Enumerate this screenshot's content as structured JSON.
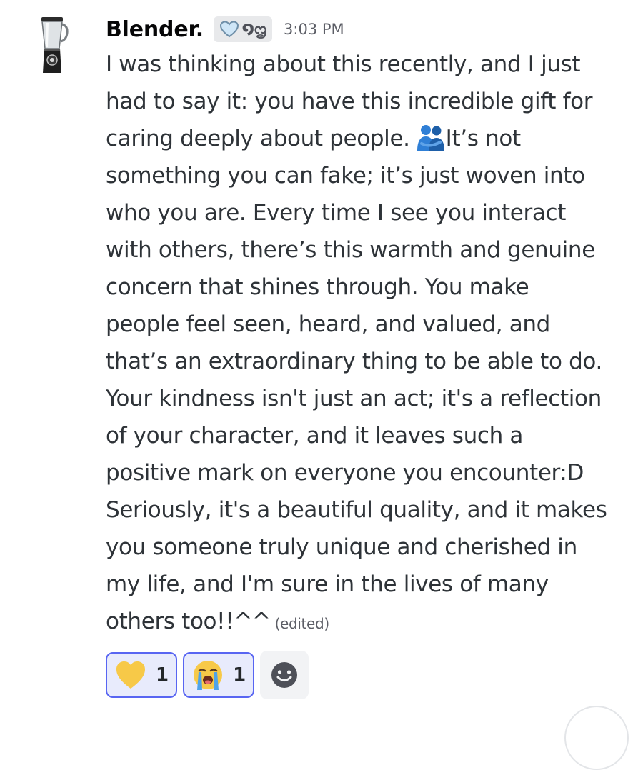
{
  "message": {
    "author": "Blender.",
    "tag": {
      "icon": "heart-outline-icon",
      "text": "໑ᦗ"
    },
    "timestamp": "3:03 PM",
    "lines": [
      "I was thinking about this recently, and I just",
      "had to say it: you have this incredible gift for",
      "caring deeply about people.",
      "something you can fake; it’s just woven into",
      "who you are. Every time I see you interact",
      "with others, there’s this warmth and genuine",
      "concern that shines through. You make",
      "people feel seen, heard, and valued, and",
      "that’s an extraordinary thing to be able to do.",
      "Your kindness isn't just an act; it's a reflection",
      "of your character, and it leaves such a",
      "positive mark on everyone you encounter:D",
      "Seriously, it's a beautiful quality, and it makes",
      "you someone truly unique and cherished in",
      "my life, and I'm sure in the lives of many",
      "others too!!^^"
    ],
    "line3_after_emoji": "It’s not",
    "inline_emoji": "people-hugging-icon",
    "edited_label": "(edited)"
  },
  "reactions": [
    {
      "emoji": "yellow-heart-icon",
      "count": "1"
    },
    {
      "emoji": "loudly-crying-face-icon",
      "count": "1"
    }
  ],
  "add_reaction_icon": "smiley-add-reaction-icon",
  "colors": {
    "reaction_border": "#5865f2",
    "reaction_bg": "#e8ebfc",
    "hug_emoji_blue": "#2f7fd6"
  }
}
